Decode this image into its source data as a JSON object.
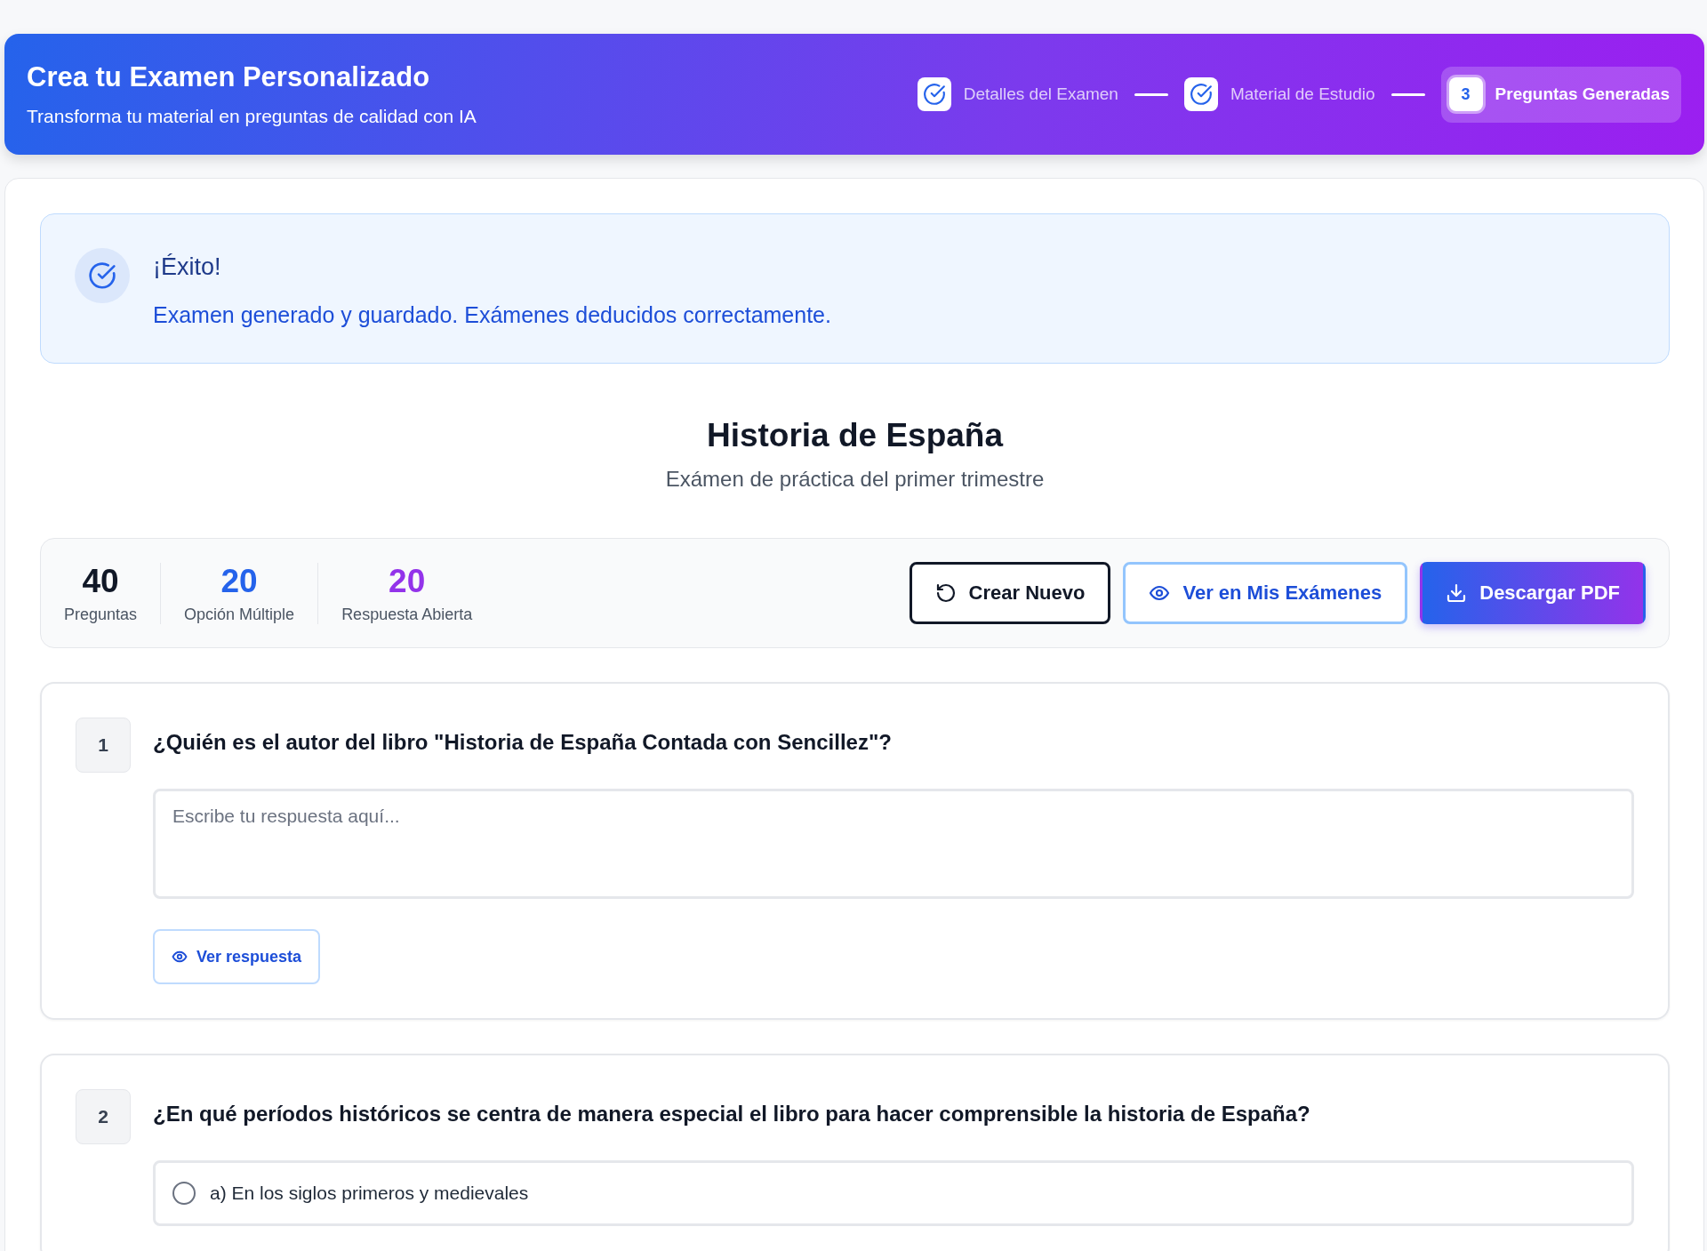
{
  "header": {
    "title": "Crea tu Examen Personalizado",
    "subtitle": "Transforma tu material en preguntas de calidad con IA",
    "steps": [
      {
        "label": "Detalles del Examen",
        "kind": "completed",
        "selected": false
      },
      {
        "label": "Material de Estudio",
        "kind": "completed",
        "selected": false
      },
      {
        "label": "Preguntas Generadas",
        "kind": "current",
        "number": "3",
        "selected": true
      }
    ]
  },
  "alert": {
    "title": "¡Éxito!",
    "message": "Examen generado y guardado. Exámenes deducidos correctamente."
  },
  "exam": {
    "title": "Historia de España",
    "subtitle": "Exámen de práctica del primer trimestre"
  },
  "stats": [
    {
      "value": "40",
      "label": "Preguntas",
      "color": "#111827"
    },
    {
      "value": "20",
      "label": "Opción Múltiple",
      "color": "#2563eb"
    },
    {
      "value": "20",
      "label": "Respuesta Abierta",
      "color": "#9333ea"
    }
  ],
  "actions": [
    {
      "label": "Crear Nuevo",
      "kind": "outline"
    },
    {
      "label": "Ver en Mis Exámenes",
      "kind": "secondary"
    },
    {
      "label": "Descargar PDF",
      "kind": "primary"
    }
  ],
  "questions": [
    {
      "number": "1",
      "text": "¿Quién es el autor del libro \"Historia de España Contada con Sencillez\"?",
      "kind": "open",
      "placeholder": "Escribe tu respuesta aquí...",
      "button": "Ver respuesta"
    },
    {
      "number": "2",
      "text": "¿En qué períodos históricos se centra de manera especial el libro para hacer comprensible la historia de España?",
      "kind": "choice",
      "options": [
        {
          "label": "a) En los siglos primeros y medievales",
          "selected": false
        }
      ]
    }
  ]
}
